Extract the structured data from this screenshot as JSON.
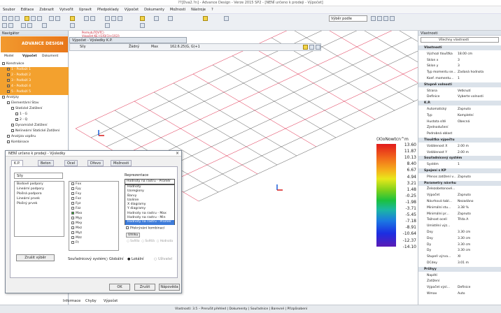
{
  "title": "??[Dva2.?n] - Advance Design - Verze 2015 SP2 - [NENÍ určeno k prodeji - Výpočet]",
  "menu": [
    "Soubor",
    "Editace",
    "Zobrazit",
    "Vytvořit",
    "Upravit",
    "Předpoklady",
    "Výpočet",
    "Dokumenty",
    "Možnosti",
    "Nástroje",
    "?"
  ],
  "toolbar": {
    "combo": "Výběr podle"
  },
  "navigator": {
    "header": "Navigátor",
    "logo": "ADVANCE DESIGN",
    "tabs": [
      "Model",
      "Výpočet",
      "Dokument"
    ],
    "tree": [
      "Konstrukce",
      "1 - Podlaží 1",
      "2 - Podlaží 2",
      "3 - Podlaží 3",
      "4 - Podlaží 4",
      "5 - Podlaží 5",
      "Analýzy",
      "Elementární Stav",
      "Statické Zatížení",
      "1 - G",
      "2 - Q",
      "Dynamické Zatížení",
      "Nelineární Statické Zatížení",
      "Analýza vzpěru",
      "Kombinace"
    ]
  },
  "warn": [
    "PermutuTOVTC)",
    "Výpočet KE ((1[Q(1)+1[G])",
    "Přidaný čas: Max",
    "Součinitel:",
    "Vybrané hodnoty"
  ],
  "viewport": {
    "header": "Výpočet - Výsledky K.P.",
    "bar": {
      "c1": "Síly",
      "c2": "Žádný",
      "c3": "Max",
      "c4": "162.6.25(G, G)+1"
    }
  },
  "scale": {
    "title": "(X)oNowtcn^m",
    "values": [
      "13.60",
      "11.87",
      "10.13",
      "8.40",
      "6.67",
      "4.94",
      "3.21",
      "1.48",
      "-0.25",
      "-1.98",
      "-3.71",
      "-5.45",
      "-7.18",
      "-8.91",
      "-10.64",
      "-12.37",
      "-14.10"
    ]
  },
  "props": {
    "header": "Vlastnosti",
    "filter": "Všechny vlastnosti",
    "rows": [
      {
        "s": true,
        "k": "Vlastnosti"
      },
      {
        "k": "Výchozí tloušťka",
        "v": "18.00 cm"
      },
      {
        "k": "Sklon x",
        "v": "3"
      },
      {
        "k": "Sklon y",
        "v": "3"
      },
      {
        "k": "Typ momentu se...",
        "v": "Zadaná hodnota"
      },
      {
        "k": "Koef. momentu...",
        "v": "1"
      },
      {
        "s": true,
        "k": "Stupně volnosti"
      },
      {
        "k": "Strana",
        "v": "Vetknutí"
      },
      {
        "k": "Definice",
        "v": "Vyberte volnosti"
      },
      {
        "s": true,
        "k": "K.P."
      },
      {
        "k": "Automatický",
        "v": "Zapnuto"
      },
      {
        "k": "Typ",
        "v": "Kompletní"
      },
      {
        "k": "Hustota sítě",
        "v": "Obecná"
      },
      {
        "k": "Zjednodušení",
        "v": ""
      },
      {
        "k": "Podrobná oblast",
        "v": ""
      },
      {
        "s": true,
        "k": "Tloušťka výpočtu"
      },
      {
        "k": "Vzdálenost X",
        "v": "2.00 m"
      },
      {
        "k": "Vzdálenost Y",
        "v": "2.00 m"
      },
      {
        "s": true,
        "k": "Souřadnicový systém"
      },
      {
        "k": "Systém",
        "v": "1"
      },
      {
        "s": true,
        "k": "Spojení s KP"
      },
      {
        "k": "Přenos zatížení v...",
        "v": "Zapnuto"
      },
      {
        "s": true,
        "k": "Parametry návrhu"
      },
      {
        "k": "Železobetonové...",
        "v": ""
      },
      {
        "k": "Výpočet",
        "v": "Zapnuto"
      },
      {
        "k": "Návrhová tabl...",
        "v": "Nezadáno"
      },
      {
        "k": "Minimální stu...",
        "v": "3.38 %"
      },
      {
        "k": "Minimální pr...",
        "v": "Zapnuto"
      },
      {
        "k": "Tažnost ocelí",
        "v": "Třída A"
      },
      {
        "k": "Umístění výz...",
        "v": ""
      },
      {
        "k": "Dxy",
        "v": "3.30 cm"
      },
      {
        "k": "Dxy",
        "v": "3.30 cm"
      },
      {
        "k": "Dy",
        "v": "3.30 cm"
      },
      {
        "k": "Dy",
        "v": "3.30 cm"
      },
      {
        "k": "Stupeň výrva...",
        "v": "XI"
      },
      {
        "k": "DCdey",
        "v": "3.01 m"
      },
      {
        "s": true,
        "k": "Průhyy"
      },
      {
        "k": "Napětí",
        "v": ""
      },
      {
        "k": "Zatížení",
        "v": ""
      },
      {
        "k": "Výpočet výsl...",
        "v": "Definice"
      },
      {
        "k": "Wmax",
        "v": "Auto"
      }
    ]
  },
  "dialog": {
    "title": "NENÍ určeno k prodeji - Výsledky",
    "close": "×",
    "tabs": [
      "K.P.",
      "Beton",
      "Ocel",
      "Dřevo",
      "Možnosti"
    ],
    "combo": "Síly",
    "left": [
      "Bodové podpory",
      "Lineární podpory",
      "Plošná podpora",
      "Lineární prvek",
      "Plošný prvek"
    ],
    "checks": [
      "Fxx",
      "Fyy",
      "Fxy",
      "Fxz",
      "Fyz",
      "Fzz",
      "Mxx",
      "Myy",
      "Mxy",
      "Mxz",
      "Myz",
      "Mzz",
      "Ft"
    ],
    "rep_label": "Reprezentace",
    "rep_value": "Hodnoty na rastru - Průměr",
    "rep": [
      "Hodnoty",
      "Izoregiony",
      "Barvy",
      "Izolinie",
      "X diagramy",
      "Y diagramy",
      "Hodnoty na rastru - Max",
      "Hodnoty na rastru - Min",
      "Hodnoty na rastru - Průměr"
    ],
    "overlay": "Překrývání kombinací",
    "bubbles": "Úhlíku",
    "radios": [
      "Světlo",
      "Světlá",
      "Hodnota"
    ],
    "deselect": "Zrušit výběr",
    "cs_label": "Souřadnicový systém",
    "cs": [
      "Globální",
      "Lokální",
      "Uživatel"
    ],
    "ok": "OK",
    "cancel": "Zrušit",
    "help": "Nápověda"
  },
  "bottomtabs": [
    "Informace",
    "Chyby",
    "Výpočet"
  ],
  "status": "Vlastnosti: 3.5 – Prerušit přehled | Dokumenty | Souřadnice | Barevné | Přizpůsobení"
}
